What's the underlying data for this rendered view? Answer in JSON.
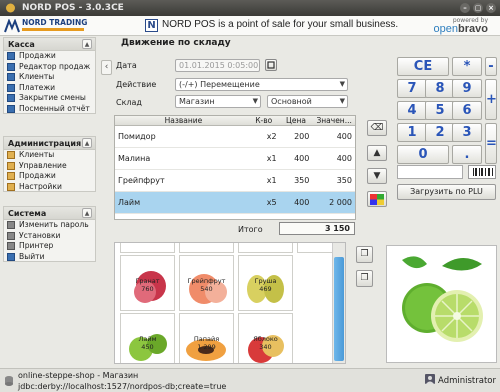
{
  "window": {
    "title": "NORD POS - 3.0.3CE"
  },
  "header": {
    "brand_name": "NORD TRADING",
    "slogan": "NORD POS is a point of sale for your small business.",
    "powered_by": "powered by",
    "openbravo_open": "open",
    "openbravo_bravo": "bravo"
  },
  "sidebar": {
    "sections": [
      {
        "title": "Касса",
        "items": [
          "Продажи",
          "Редактор продаж",
          "Клиенты",
          "Платежи",
          "Закрытие смены",
          "Посменный отчёт"
        ]
      },
      {
        "title": "Администрация",
        "items": [
          "Клиенты",
          "Управление",
          "Продажи",
          "Настройки"
        ]
      },
      {
        "title": "Система",
        "items": [
          "Изменить пароль",
          "Установки",
          "Принтер",
          "Выйти"
        ]
      }
    ]
  },
  "main": {
    "title": "Движение по складу",
    "form": {
      "date_label": "Дата",
      "date_value": "01.01.2015 0:05:00",
      "action_label": "Действие",
      "action_value": "(-/+) Перемещение",
      "warehouse_label": "Склад",
      "warehouse_from": "Магазин",
      "warehouse_to": "Основной"
    },
    "table": {
      "columns": [
        "Название",
        "К-во",
        "Цена",
        "Значен..."
      ],
      "rows": [
        {
          "name": "Помидор",
          "qty": "x2",
          "price": "200",
          "value": "400"
        },
        {
          "name": "Малина",
          "qty": "x1",
          "price": "400",
          "value": "400"
        },
        {
          "name": "Грейпфрут",
          "qty": "x1",
          "price": "350",
          "value": "350"
        },
        {
          "name": "Лайм",
          "qty": "x5",
          "price": "400",
          "value": "2 000"
        }
      ],
      "selected_row": 3
    },
    "total_label": "Итого",
    "total_value": "3 150"
  },
  "keypad": {
    "keys": [
      "CE",
      "*",
      "-",
      "7",
      "8",
      "9",
      "+",
      "4",
      "5",
      "6",
      "1",
      "2",
      "3",
      "=",
      "0",
      "."
    ],
    "plu_button": "Загрузить по PLU"
  },
  "catalog": {
    "tiles": [
      {
        "name": "Гранат",
        "price": "760"
      },
      {
        "name": "Грейпфрут",
        "price": "540"
      },
      {
        "name": "Груша",
        "price": "469"
      },
      {
        "name": "Лайм",
        "price": "450"
      },
      {
        "name": "Папайя",
        "price": "1 299"
      },
      {
        "name": "Яблоко",
        "price": "340"
      }
    ]
  },
  "status": {
    "line1": "online-steppe-shop - Магазин",
    "line2": "jdbc:derby://localhost:1527/nordpos-db;create=true",
    "user": "Administrator"
  }
}
